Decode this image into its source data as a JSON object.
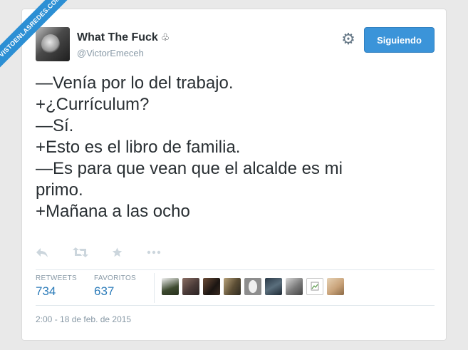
{
  "watermark": "VISTOENLASREDES.COM",
  "tweet": {
    "display_name": "What The Fuck",
    "display_name_symbol": "♧",
    "handle": "@VictorEmeceh",
    "follow_label": "Siguiendo",
    "lines": [
      "—Venía por lo del trabajo.",
      "+¿Currículum?",
      "—Sí.",
      "+Esto es el libro de familia.",
      "—Es para que vean que el alcalde es mi",
      "primo.",
      "+Mañana a las ocho"
    ],
    "actions": {
      "reply_icon": "reply-icon",
      "retweet_icon": "retweet-icon",
      "favorite_icon": "star-icon",
      "more_icon": "more-icon"
    },
    "stats": {
      "retweets_label": "RETWEETS",
      "retweets_value": "734",
      "favorites_label": "FAVORITOS",
      "favorites_value": "637"
    },
    "timestamp": "2:00 - 18 de feb. de 2015"
  },
  "colors": {
    "follow_button": "#3b94d9",
    "stat_value": "#2b7bb9",
    "ribbon": "#2c8fd4"
  }
}
